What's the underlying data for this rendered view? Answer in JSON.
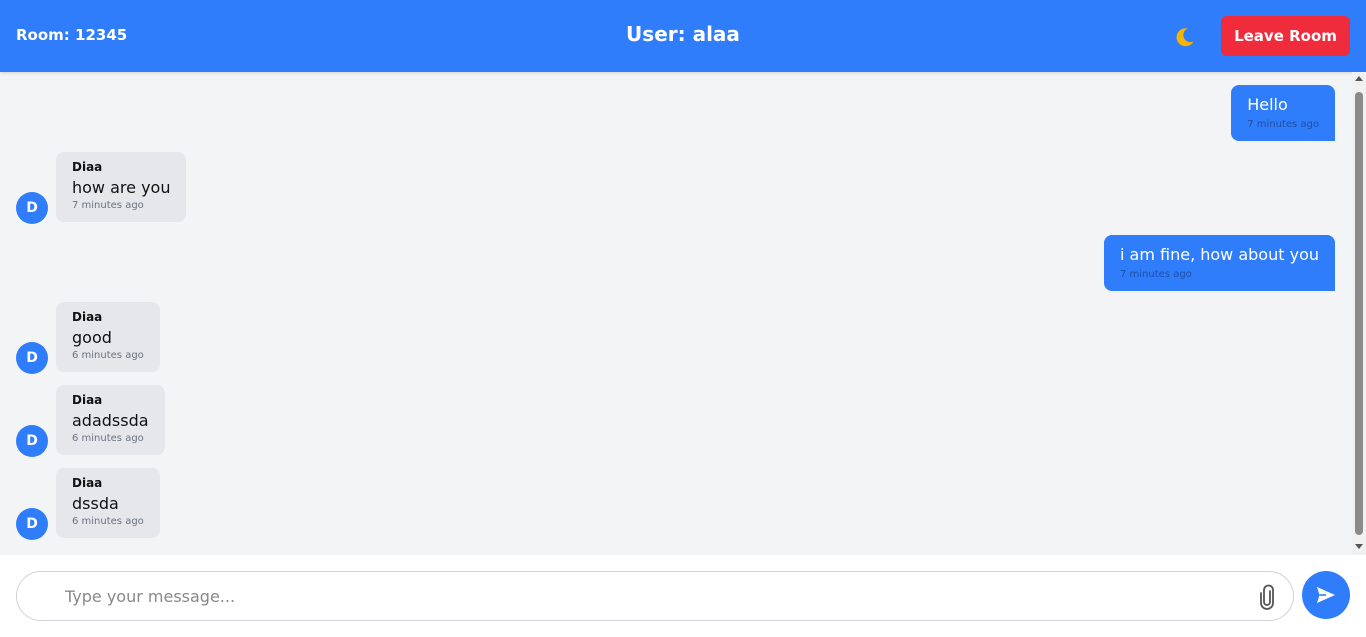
{
  "header": {
    "room_label": "Room: 12345",
    "user_label": "User: alaa",
    "leave_button": "Leave Room"
  },
  "theme": {
    "accent": "#2f7dfb",
    "danger": "#ef2b3c",
    "moon": "#f5b400"
  },
  "messages": [
    {
      "direction": "out",
      "text": "Hello",
      "time": "7 minutes ago"
    },
    {
      "direction": "in",
      "sender": "Diaa",
      "avatar": "D",
      "text": "how are you",
      "time": "7 minutes ago"
    },
    {
      "direction": "out",
      "text": "i am fine, how about you",
      "time": "7 minutes ago"
    },
    {
      "direction": "in",
      "sender": "Diaa",
      "avatar": "D",
      "text": "good",
      "time": "6 minutes ago"
    },
    {
      "direction": "in",
      "sender": "Diaa",
      "avatar": "D",
      "text": "adadssda",
      "time": "6 minutes ago"
    },
    {
      "direction": "in",
      "sender": "Diaa",
      "avatar": "D",
      "text": "dssda",
      "time": "6 minutes ago"
    }
  ],
  "composer": {
    "placeholder": "Type your message...",
    "value": ""
  },
  "icons": {
    "theme_toggle": "moon-icon",
    "attach": "paperclip-icon",
    "send": "send-icon"
  }
}
